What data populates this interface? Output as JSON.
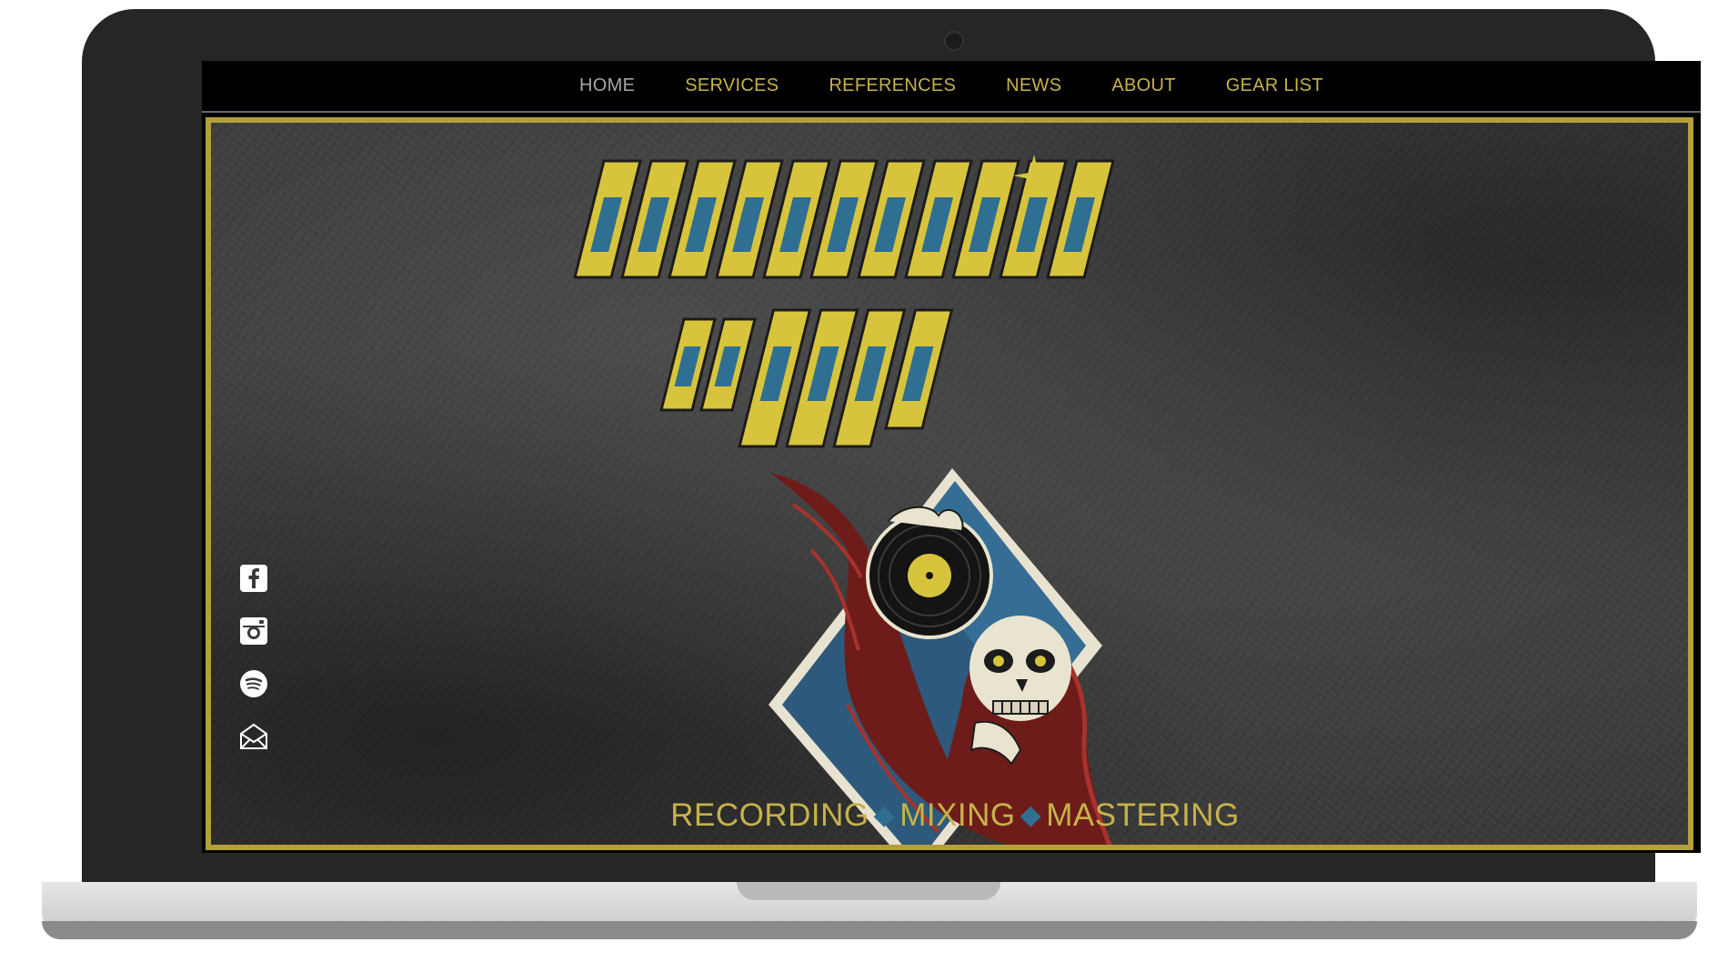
{
  "nav": {
    "items": [
      {
        "label": "HOME",
        "active": true
      },
      {
        "label": "SERVICES"
      },
      {
        "label": "REFERENCES"
      },
      {
        "label": "NEWS"
      },
      {
        "label": "ABOUT"
      },
      {
        "label": "GEAR LIST"
      }
    ]
  },
  "hero": {
    "tagline": {
      "words": [
        "RECORDING",
        "MIXING",
        "MASTERING"
      ],
      "separator": "◆"
    },
    "logo": {
      "icon": "studio-logo-illustration"
    }
  },
  "social": {
    "links": [
      {
        "icon": "facebook-icon"
      },
      {
        "icon": "instagram-icon"
      },
      {
        "icon": "spotify-icon"
      },
      {
        "icon": "email-icon"
      }
    ]
  },
  "colors": {
    "accent": "#c6b24a",
    "frame": "#b49f3a",
    "blue": "#2f6f92",
    "nav_active": "#a6a6a6",
    "background": "#3a3a3a"
  }
}
